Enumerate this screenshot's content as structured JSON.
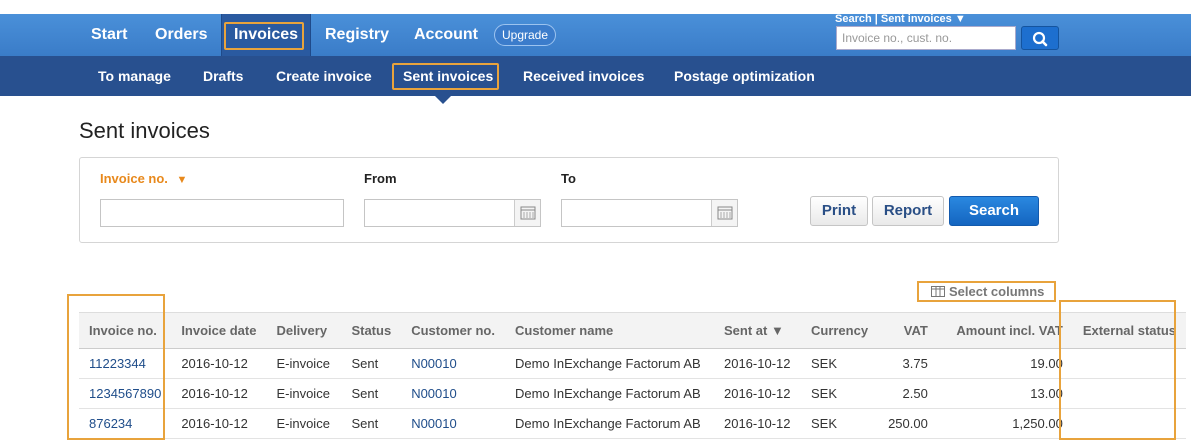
{
  "topnav": {
    "items": [
      "Start",
      "Orders",
      "Invoices",
      "Registry",
      "Account"
    ],
    "upgrade": "Upgrade",
    "search_mode": "Search | Sent invoices ▼",
    "search_placeholder": "Invoice no., cust. no."
  },
  "subnav": {
    "items": [
      "To manage",
      "Drafts",
      "Create invoice",
      "Sent invoices",
      "Received invoices",
      "Postage optimization"
    ]
  },
  "page_title": "Sent invoices",
  "filters": {
    "invoice_label": "Invoice no.",
    "from_label": "From",
    "to_label": "To",
    "print": "Print",
    "report": "Report",
    "search": "Search"
  },
  "select_columns": "Select columns",
  "table": {
    "headers": [
      "Invoice no.",
      "Invoice date",
      "Delivery",
      "Status",
      "Customer no.",
      "Customer name",
      "Sent at ▼",
      "Currency",
      "VAT",
      "Amount incl. VAT",
      "External status"
    ],
    "rows": [
      [
        "11223344",
        "2016-10-12",
        "E-invoice",
        "Sent",
        "N00010",
        "Demo InExchange Factorum AB",
        "2016-10-12",
        "SEK",
        "3.75",
        "19.00",
        ""
      ],
      [
        "1234567890",
        "2016-10-12",
        "E-invoice",
        "Sent",
        "N00010",
        "Demo InExchange Factorum AB",
        "2016-10-12",
        "SEK",
        "2.50",
        "13.00",
        ""
      ],
      [
        "876234",
        "2016-10-12",
        "E-invoice",
        "Sent",
        "N00010",
        "Demo InExchange Factorum AB",
        "2016-10-12",
        "SEK",
        "250.00",
        "1,250.00",
        ""
      ]
    ]
  }
}
